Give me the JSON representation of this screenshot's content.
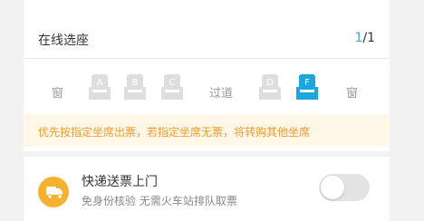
{
  "section": {
    "title": "在线选座",
    "count_current": "1",
    "count_total": "/1"
  },
  "seats": {
    "window_left": "窗",
    "aisle": "过道",
    "window_right": "窗",
    "items": [
      {
        "letter": "A",
        "selected": false
      },
      {
        "letter": "B",
        "selected": false
      },
      {
        "letter": "C",
        "selected": false
      },
      {
        "letter": "D",
        "selected": false
      },
      {
        "letter": "F",
        "selected": true
      }
    ],
    "colors": {
      "unselected": "#dedede",
      "selected": "#1ca6e0"
    }
  },
  "notice": {
    "text": "优先按指定坐席出票，若指定坐席无票，将转购其他坐席"
  },
  "express": {
    "icon": "delivery-icon",
    "title": "快递送票上门",
    "subtitle": "免身份核验 无需火车站排队取票",
    "toggle_on": false
  }
}
